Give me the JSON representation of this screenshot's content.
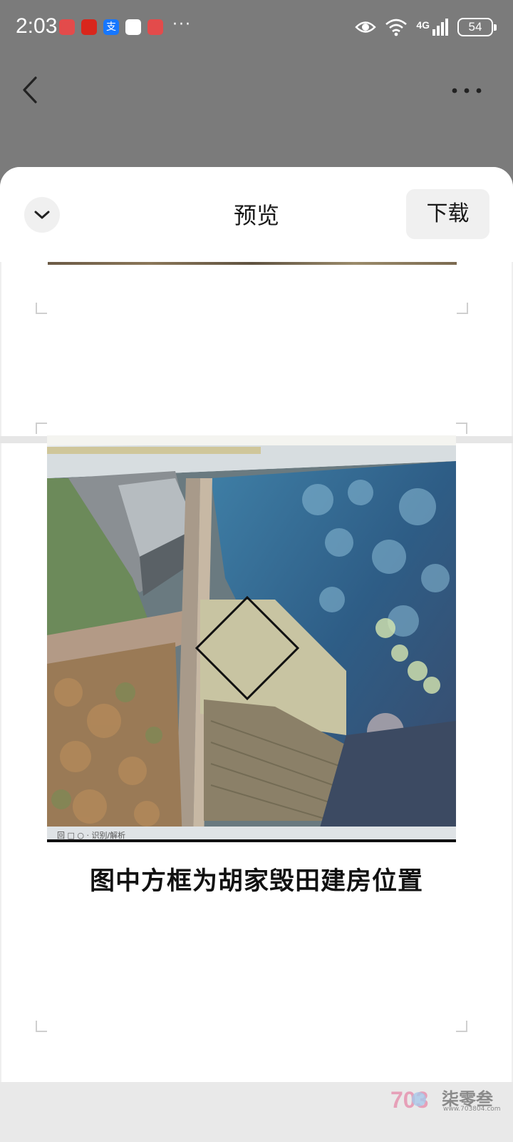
{
  "status_bar": {
    "time": "2:03",
    "more_notifications": "···",
    "network_label": "4G",
    "battery": "54"
  },
  "nav": {
    "back_icon": "chevron-left-icon",
    "more_icon": "more-horizontal-icon"
  },
  "sheet": {
    "title": "预览",
    "collapse_icon": "chevron-down-icon",
    "download_label": "下载"
  },
  "document": {
    "caption": "图中方框为胡家毁田建房位置",
    "photo_toolbar_text": "回 □ ○ · 识别/解析"
  },
  "watermark": {
    "text": "柒零叁",
    "url": "www.703804.com"
  },
  "colors": {
    "overlay": "#7b7b7b",
    "sheet": "#ffffff",
    "button_bg": "#f0f0f0",
    "text": "#1a1a1a"
  }
}
